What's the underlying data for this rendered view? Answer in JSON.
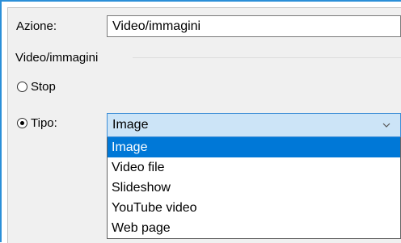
{
  "form": {
    "azione_label": "Azione:",
    "azione_value": "Video/immagini",
    "group_title": "Video/immagini",
    "stop_label": "Stop",
    "tipo_label": "Tipo:",
    "stop_selected": false,
    "tipo_selected": true
  },
  "select": {
    "value": "Image",
    "icon": "chevron-down-icon",
    "options": [
      "Image",
      "Video file",
      "Slideshow",
      "YouTube video",
      "Web page"
    ],
    "highlighted_index": 0
  },
  "colors": {
    "accent": "#2b8fd8",
    "selection": "#0078d7",
    "select_background": "#cce4f7"
  }
}
